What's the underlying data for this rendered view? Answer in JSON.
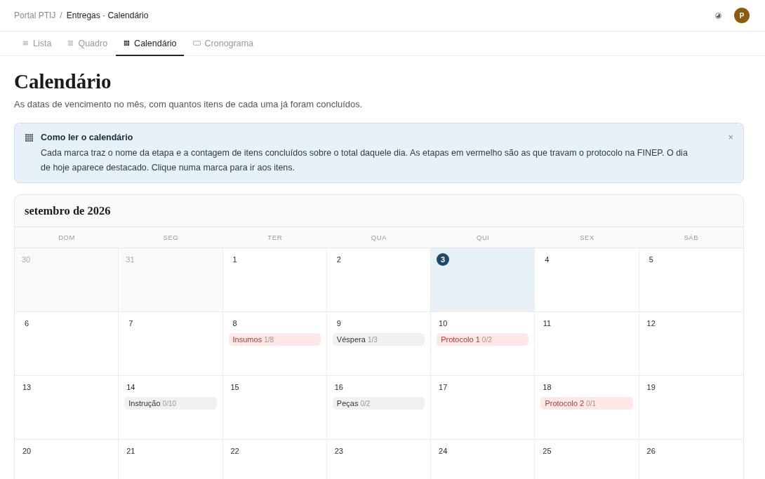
{
  "breadcrumb": {
    "parent": "Portal PTIJ",
    "separator": "/",
    "current": "Entregas · Calendário"
  },
  "avatar": {
    "initial": "P"
  },
  "tabs": [
    {
      "label": "Lista",
      "kind": "list",
      "selected": false
    },
    {
      "label": "Quadro",
      "kind": "board",
      "selected": false
    },
    {
      "label": "Calendário",
      "kind": "calendar",
      "selected": true
    },
    {
      "label": "Cronograma",
      "kind": "timeline",
      "selected": false
    }
  ],
  "page": {
    "title": "Calendário",
    "subtitle": "As datas de vencimento no mês, com quantos itens de cada uma já foram concluídos."
  },
  "notice": {
    "title": "Como ler o calendário",
    "body": "Cada marca traz o nome da etapa e a contagem de itens concluídos sobre o total daquele dia. As etapas em vermelho são as que travam o protocolo na FINEP. O dia de hoje aparece destacado. Clique numa marca para ir aos itens.",
    "close": "×"
  },
  "calendar": {
    "month": "setembro de 2026",
    "weekdays": [
      "DOM",
      "SEG",
      "TER",
      "QUA",
      "QUI",
      "SEX",
      "SÁB"
    ],
    "weeks": [
      {
        "days": [
          {
            "day": "30",
            "outside": true,
            "today": false
          },
          {
            "day": "31",
            "outside": true,
            "today": false
          },
          {
            "day": "1",
            "outside": false,
            "today": false
          },
          {
            "day": "2",
            "outside": false,
            "today": false
          },
          {
            "day": "3",
            "outside": false,
            "today": true
          },
          {
            "day": "4",
            "outside": false,
            "today": false
          },
          {
            "day": "5",
            "outside": false,
            "today": false
          }
        ]
      },
      {
        "days": [
          {
            "day": "6",
            "outside": false,
            "today": false
          },
          {
            "day": "7",
            "outside": false,
            "today": false
          },
          {
            "day": "8",
            "outside": false,
            "today": false,
            "marks": [
              {
                "label": "Insumos",
                "count": "1/8",
                "blocking": true
              }
            ]
          },
          {
            "day": "9",
            "outside": false,
            "today": false,
            "marks": [
              {
                "label": "Véspera",
                "count": "1/3",
                "blocking": false
              }
            ]
          },
          {
            "day": "10",
            "outside": false,
            "today": false,
            "marks": [
              {
                "label": "Protocolo 1",
                "count": "0/2",
                "blocking": true
              }
            ]
          },
          {
            "day": "11",
            "outside": false,
            "today": false
          },
          {
            "day": "12",
            "outside": false,
            "today": false
          }
        ]
      },
      {
        "days": [
          {
            "day": "13",
            "outside": false,
            "today": false
          },
          {
            "day": "14",
            "outside": false,
            "today": false,
            "marks": [
              {
                "label": "Instrução",
                "count": "0/10",
                "blocking": false
              }
            ]
          },
          {
            "day": "15",
            "outside": false,
            "today": false
          },
          {
            "day": "16",
            "outside": false,
            "today": false,
            "marks": [
              {
                "label": "Peças",
                "count": "0/2",
                "blocking": false
              }
            ]
          },
          {
            "day": "17",
            "outside": false,
            "today": false
          },
          {
            "day": "18",
            "outside": false,
            "today": false,
            "marks": [
              {
                "label": "Protocolo 2",
                "count": "0/1",
                "blocking": true
              }
            ]
          },
          {
            "day": "19",
            "outside": false,
            "today": false
          }
        ]
      },
      {
        "days": [
          {
            "day": "20",
            "outside": false,
            "today": false
          },
          {
            "day": "21",
            "outside": false,
            "today": false
          },
          {
            "day": "22",
            "outside": false,
            "today": false
          },
          {
            "day": "23",
            "outside": false,
            "today": false
          },
          {
            "day": "24",
            "outside": false,
            "today": false
          },
          {
            "day": "25",
            "outside": false,
            "today": false
          },
          {
            "day": "26",
            "outside": false,
            "today": false
          }
        ]
      }
    ]
  }
}
